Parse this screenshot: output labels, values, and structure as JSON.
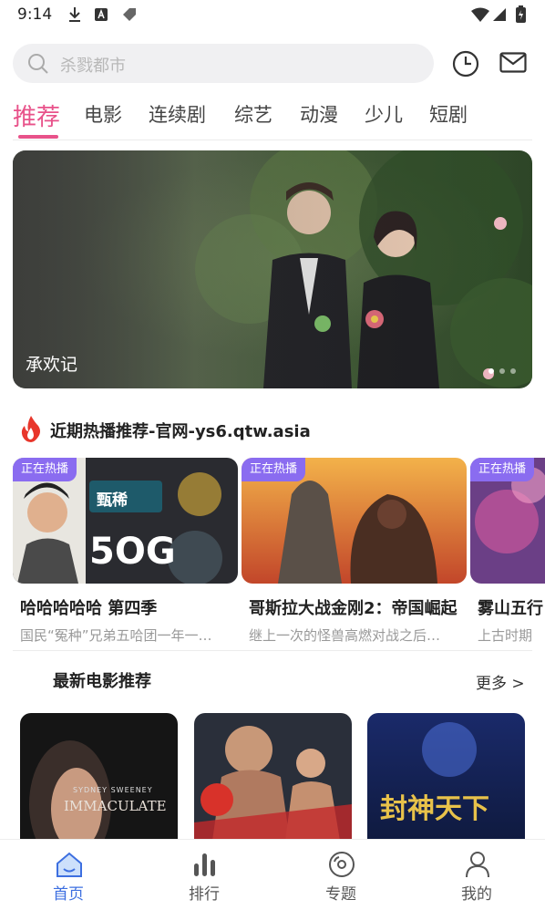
{
  "status_bar": {
    "time": "9:14"
  },
  "search": {
    "placeholder": "杀戮都市"
  },
  "tabs": [
    {
      "label": "推荐",
      "active": true
    },
    {
      "label": "电影"
    },
    {
      "label": "连续剧"
    },
    {
      "label": "综艺"
    },
    {
      "label": "动漫"
    },
    {
      "label": "少儿"
    },
    {
      "label": "短剧"
    }
  ],
  "banner": {
    "title": "承欢记"
  },
  "hot_section": {
    "title": "近期热播推荐-官网-ys6.qtw.asia",
    "badge_label": "正在热播",
    "items": [
      {
        "title": "哈哈哈哈哈 第四季",
        "desc": "国民“冤种”兄弟五哈团一年一…",
        "poster_text": "甄稀",
        "poster_text2": "5OG"
      },
      {
        "title": "哥斯拉大战金刚2：帝国崛起",
        "desc": "继上一次的怪兽高燃对战之后…"
      },
      {
        "title": "雾山五行",
        "desc": "上古时期"
      }
    ]
  },
  "latest_section": {
    "title": "最新电影推荐",
    "more_label": "更多 >",
    "movies": [
      {
        "poster_text": "IMMACULATE",
        "poster_sub": "SYDNEY SWEENEY"
      },
      {
        "poster_text": ""
      },
      {
        "poster_text": "封神天下"
      }
    ]
  },
  "bottom_nav": [
    {
      "label": "首页",
      "icon": "home-icon",
      "active": true
    },
    {
      "label": "排行",
      "icon": "rank-bars-icon"
    },
    {
      "label": "专题",
      "icon": "disc-icon"
    },
    {
      "label": "我的",
      "icon": "user-icon"
    }
  ],
  "colors": {
    "accent_pink": "#e8528a",
    "badge_purple": "#8a6cf0",
    "nav_active": "#3d6fe0"
  }
}
